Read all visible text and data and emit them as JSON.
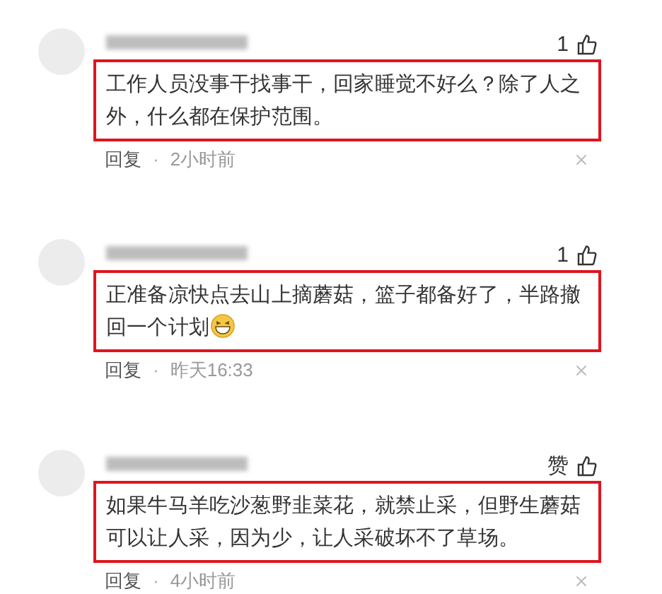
{
  "comments": [
    {
      "like_label": "1",
      "text": "工作人员没事干找事干，回家睡觉不好么？除了人之外，什么都在保护范围。",
      "emoji": false,
      "highlighted": true,
      "reply": "回复",
      "separator": "·",
      "time": "2小时前"
    },
    {
      "like_label": "1",
      "text": "正准备凉快点去山上摘蘑菇，篮子都备好了，半路撤回一个计划",
      "emoji": true,
      "highlighted": true,
      "reply": "回复",
      "separator": "·",
      "time": "昨天16:33"
    },
    {
      "like_label": "赞",
      "text": "如果牛马羊吃沙葱野韭菜花，就禁止采，但野生蘑菇可以让人采，因为少，让人采破坏不了草场。",
      "emoji": false,
      "highlighted": true,
      "reply": "回复",
      "separator": "·",
      "time": "4小时前"
    }
  ]
}
